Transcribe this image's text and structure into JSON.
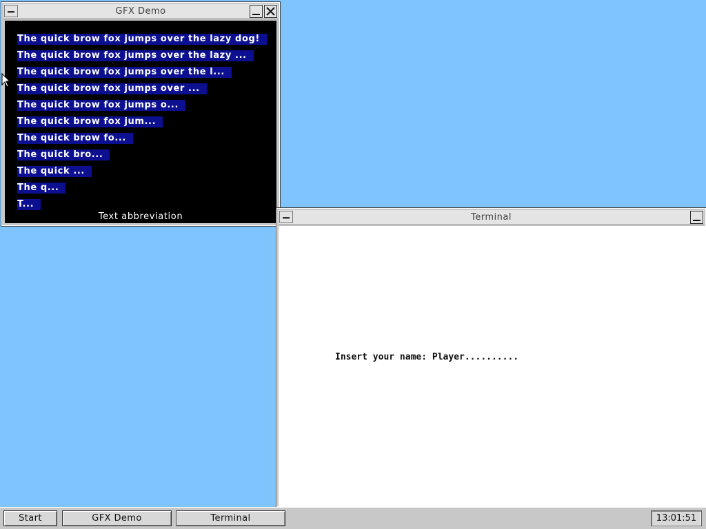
{
  "gfx_window": {
    "title": "GFX Demo",
    "lines": [
      "The quick brow fox jumps over the lazy dog!",
      "The quick brow fox jumps over the lazy ...",
      "The quick brow fox jumps over the l...",
      "The quick brow fox jumps over ...",
      "The quick brow fox jumps o...",
      "The quick brow fox jum...",
      "The quick brow fo...",
      "The quick bro...",
      "The quick ...",
      "The q...",
      "T..."
    ],
    "caption": "Text abbreviation"
  },
  "terminal_window": {
    "title": "Terminal",
    "prompt": "Insert your name: Player.........."
  },
  "taskbar": {
    "start_label": "Start",
    "tasks": [
      "GFX Demo",
      "Terminal"
    ],
    "clock": "13:01:51"
  },
  "colors": {
    "desktop": "#80c4fd",
    "text_highlight": "#0c1090"
  }
}
